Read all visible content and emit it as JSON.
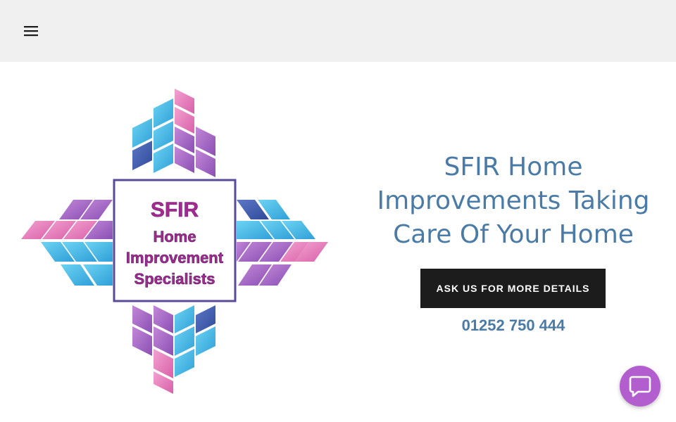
{
  "header": {
    "menu_icon": "hamburger-menu-icon"
  },
  "logo": {
    "line1": "SFIR",
    "line2": "Home",
    "line3": "Improvement",
    "line4": "Specialists",
    "colors": {
      "pink": "#e07ab8",
      "blue": "#3db4e5",
      "purple": "#9b59b6",
      "dark_blue": "#3a5aa8",
      "text_magenta": "#a8298c",
      "text_purple": "#6a2a8c"
    }
  },
  "hero": {
    "headline": "SFIR Home Improvements Taking Care Of Your Home",
    "cta_label": "ASK US FOR MORE DETAILS",
    "phone": "01252 750 444"
  },
  "chat": {
    "icon": "chat-bubble-icon",
    "color": "#b25ecf"
  },
  "colors": {
    "accent": "#4a7ba6",
    "header_bg": "#f0f0f0",
    "button_bg": "#1c1c1c"
  }
}
